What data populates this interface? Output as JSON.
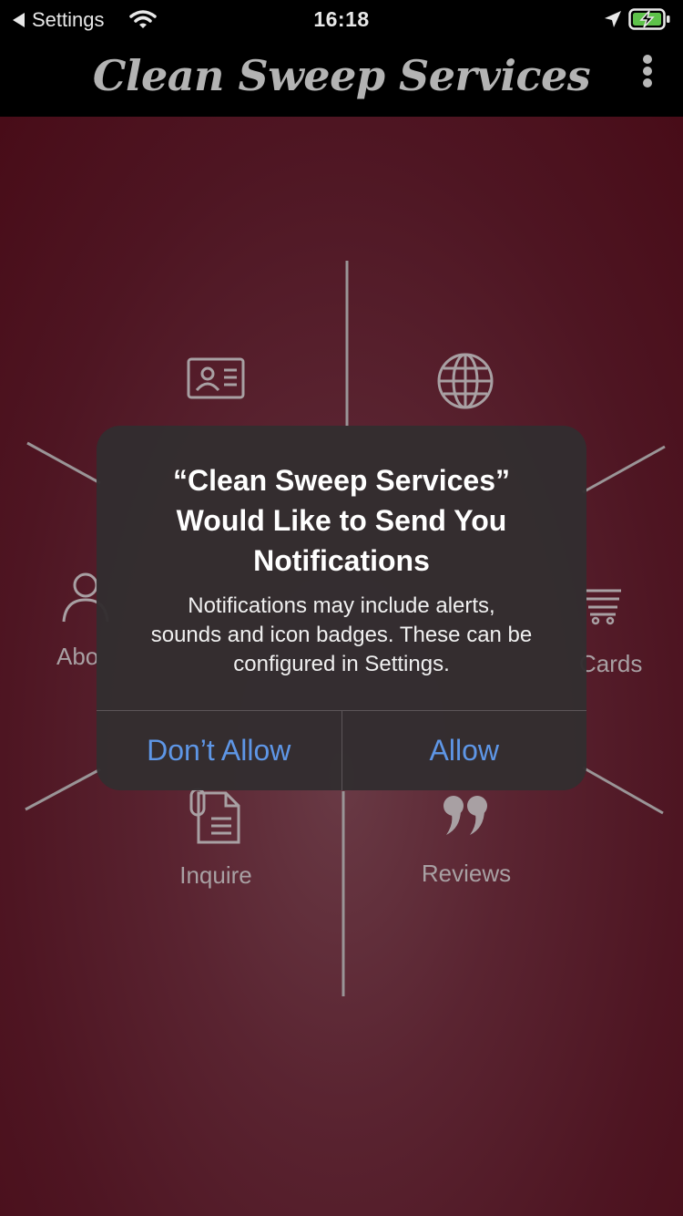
{
  "status_bar": {
    "back_label": "Settings",
    "time": "16:18",
    "icons": [
      "back-triangle-icon",
      "wifi-icon",
      "location-arrow-icon",
      "battery-charging-icon"
    ]
  },
  "header": {
    "title": "Clean Sweep Services",
    "menu_icon": "more-vertical-icon"
  },
  "tiles": {
    "contact": {
      "icon": "id-card-icon",
      "label": ""
    },
    "website": {
      "icon": "globe-icon",
      "label": ""
    },
    "about": {
      "icon": "person-icon",
      "label": "Abo"
    },
    "cards": {
      "icon": "cart-icon",
      "label": "Cards"
    },
    "inquire": {
      "icon": "document-clip-icon",
      "label": "Inquire"
    },
    "reviews": {
      "icon": "quote-icon",
      "label": "Reviews"
    }
  },
  "alert": {
    "title": "“Clean Sweep Services”\nWould Like to Send You\nNotifications",
    "message": "Notifications may include alerts,\nsounds and icon badges. These can be\nconfigured in Settings.",
    "deny_label": "Don’t Allow",
    "allow_label": "Allow"
  },
  "colors": {
    "background": "#5a2431",
    "alert_bg": "#332d2f",
    "button_blue": "#5e96e6",
    "title_gray": "#b3b3b3",
    "battery_green": "#5ec24a"
  }
}
